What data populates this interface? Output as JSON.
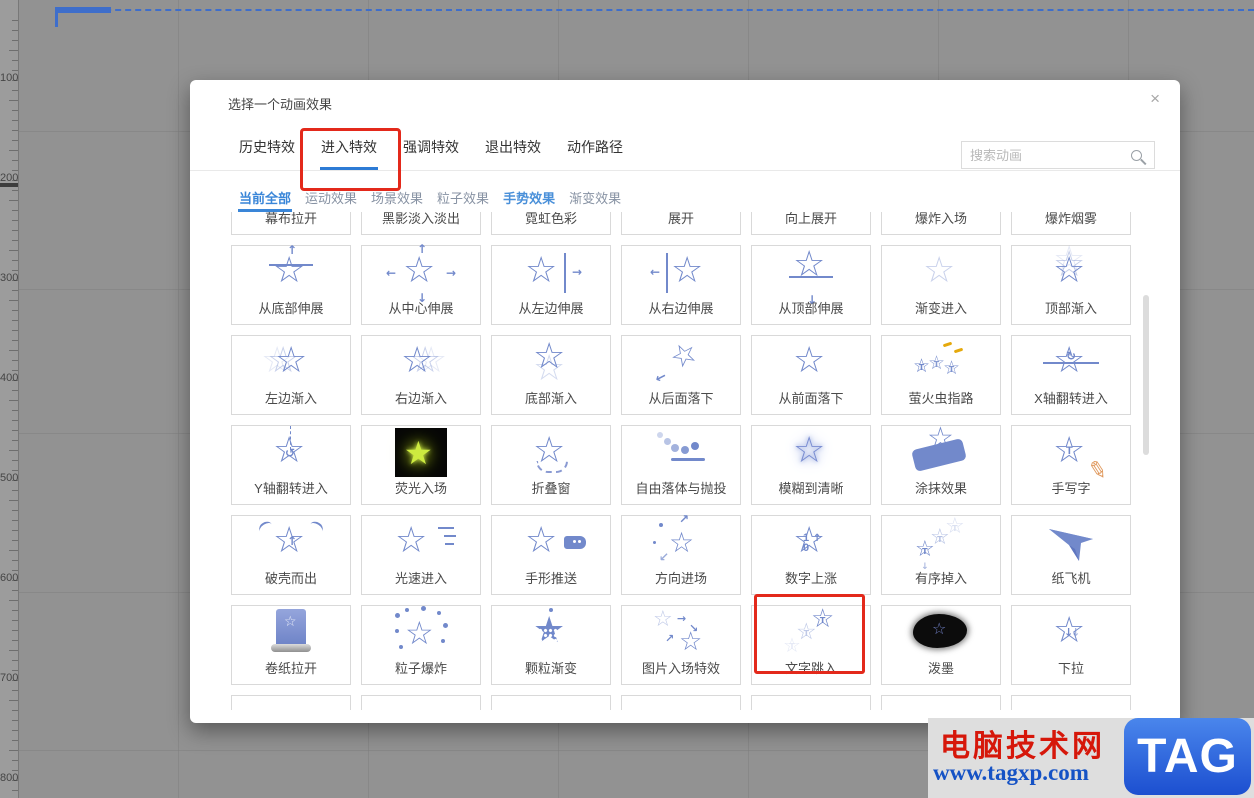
{
  "canvas": {
    "ruler_labels": [
      "100",
      "200",
      "300",
      "400",
      "500",
      "600",
      "700",
      "800"
    ]
  },
  "dialog": {
    "title": "选择一个动画效果",
    "close_label": "×",
    "tabs": [
      {
        "label": "历史特效",
        "active": false
      },
      {
        "label": "进入特效",
        "active": true,
        "highlighted": true
      },
      {
        "label": "强调特效",
        "active": false
      },
      {
        "label": "退出特效",
        "active": false
      },
      {
        "label": "动作路径",
        "active": false
      }
    ],
    "subtabs": [
      {
        "label": "当前全部",
        "active": true
      },
      {
        "label": "运动效果",
        "active": false
      },
      {
        "label": "场景效果",
        "active": false
      },
      {
        "label": "粒子效果",
        "active": false
      },
      {
        "label": "手势效果",
        "active": false,
        "accent": true
      },
      {
        "label": "渐变效果",
        "active": false
      }
    ],
    "search": {
      "placeholder": "搜索动画"
    },
    "rows": [
      {
        "tiles": [
          {
            "label": "幕布拉开",
            "icon": null
          },
          {
            "label": "黑影淡入淡出",
            "icon": null
          },
          {
            "label": "霓虹色彩",
            "icon": null
          },
          {
            "label": "展开",
            "icon": null
          },
          {
            "label": "向上展开",
            "icon": null
          },
          {
            "label": "爆炸入场",
            "icon": null
          },
          {
            "label": "爆炸烟雾",
            "icon": null
          }
        ]
      },
      {
        "tiles": [
          {
            "label": "从底部伸展",
            "icon": "star-stretch-bottom"
          },
          {
            "label": "从中心伸展",
            "icon": "star-stretch-center"
          },
          {
            "label": "从左边伸展",
            "icon": "star-stretch-left"
          },
          {
            "label": "从右边伸展",
            "icon": "star-stretch-right"
          },
          {
            "label": "从顶部伸展",
            "icon": "star-stretch-top"
          },
          {
            "label": "渐变进入",
            "icon": "star-fade"
          },
          {
            "label": "顶部渐入",
            "icon": "star-slide-top"
          }
        ]
      },
      {
        "tiles": [
          {
            "label": "左边渐入",
            "icon": "star-fade-left"
          },
          {
            "label": "右边渐入",
            "icon": "star-fade-right"
          },
          {
            "label": "底部渐入",
            "icon": "star-fade-bottom"
          },
          {
            "label": "从后面落下",
            "icon": "star-drop-back"
          },
          {
            "label": "从前面落下",
            "icon": "star-drop-front"
          },
          {
            "label": "萤火虫指路",
            "icon": "firefly-stars"
          },
          {
            "label": "X轴翻转进入",
            "icon": "star-flip-x"
          }
        ]
      },
      {
        "tiles": [
          {
            "label": "Y轴翻转进入",
            "icon": "star-flip-y"
          },
          {
            "label": "荧光入场",
            "icon": "neon-star"
          },
          {
            "label": "折叠窗",
            "icon": "star-fold"
          },
          {
            "label": "自由落体与抛投",
            "icon": "dots-throw"
          },
          {
            "label": "模糊到清晰",
            "icon": "star-blur"
          },
          {
            "label": "涂抹效果",
            "icon": "brush-smear"
          },
          {
            "label": "手写字",
            "icon": "hand-writing"
          }
        ]
      },
      {
        "tiles": [
          {
            "label": "破壳而出",
            "icon": "star-hatch"
          },
          {
            "label": "光速进入",
            "icon": "star-speed"
          },
          {
            "label": "手形推送",
            "icon": "star-push"
          },
          {
            "label": "方向进场",
            "icon": "star-directions"
          },
          {
            "label": "数字上涨",
            "icon": "star-numbers"
          },
          {
            "label": "有序掉入",
            "icon": "stars-ordered-drop"
          },
          {
            "label": "纸飞机",
            "icon": "paper-plane"
          }
        ]
      },
      {
        "tiles": [
          {
            "label": "卷纸拉开",
            "icon": "scroll-paper"
          },
          {
            "label": "粒子爆炸",
            "icon": "star-particles"
          },
          {
            "label": "颗粒渐变",
            "icon": "star-grain"
          },
          {
            "label": "图片入场特效",
            "icon": "stars-pic-entry"
          },
          {
            "label": "文字跳入",
            "icon": "stars-text-jump",
            "selected": true
          },
          {
            "label": "泼墨",
            "icon": "ink-splash"
          },
          {
            "label": "下拉",
            "icon": "star-pulldown"
          }
        ]
      },
      {
        "tiles": [
          {
            "label": "",
            "icon": null
          },
          {
            "label": "",
            "icon": null
          },
          {
            "label": "",
            "icon": null
          },
          {
            "label": "",
            "icon": null
          },
          {
            "label": "",
            "icon": null
          },
          {
            "label": "",
            "icon": null
          },
          {
            "label": "",
            "icon": null
          }
        ]
      }
    ]
  },
  "watermark": {
    "site_name": "电脑技术网",
    "site_url": "www.tagxp.com",
    "badge": "TAG"
  }
}
